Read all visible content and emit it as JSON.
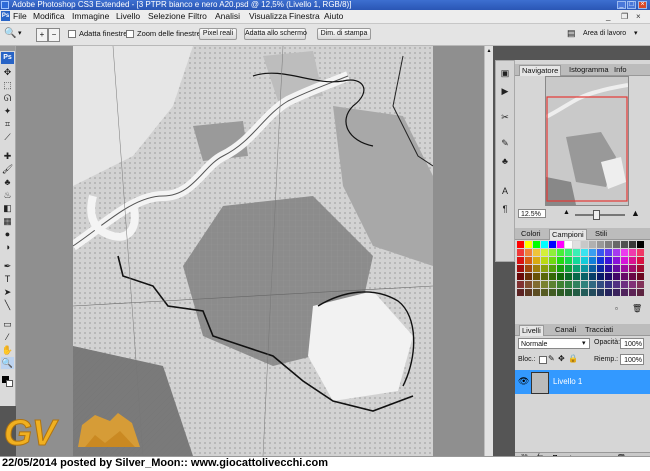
{
  "window": {
    "title": "Adobe Photoshop CS3 Extended - [3 PTPR bianco e nero A20.psd @ 12,5% (Livello 1, RGB/8)]"
  },
  "menu": {
    "items": [
      "File",
      "Modifica",
      "Immagine",
      "Livello",
      "Selezione",
      "Filtro",
      "Analisi",
      "Visualizza",
      "Finestra",
      "Aiuto"
    ]
  },
  "options": {
    "adatta_finestre": "Adatta finestre",
    "zoom_finestre": "Zoom delle finestre",
    "pixel_reali": "Pixel reali",
    "adatta_schermo": "Adatta allo schermo",
    "dim_stampa": "Dim. di stampa",
    "workspace_label": "Area di lavoro"
  },
  "navigator": {
    "tabs": [
      "Navigatore",
      "Istogramma",
      "Info"
    ],
    "zoom": "12.5%"
  },
  "swatches": {
    "tabs": [
      "Colori",
      "Campioni",
      "Stili"
    ]
  },
  "layers": {
    "tabs": [
      "Livelli",
      "Canali",
      "Tracciati"
    ],
    "blend_mode": "Normale",
    "opacity_label": "Opacità:",
    "opacity_value": "100%",
    "lock_label": "Bloc.:",
    "fill_label": "Riemp.:",
    "fill_value": "100%",
    "layer_name": "Livello 1"
  },
  "overlay": {
    "logo_text": "GV",
    "caption": "22/05/2014 posted by Silver_Moon:: www.giocattolivecchi.com"
  },
  "colors": {
    "accent_blue": "#3399ff",
    "titlebar": "#2a56b5",
    "nav_frame": "#e53935"
  }
}
